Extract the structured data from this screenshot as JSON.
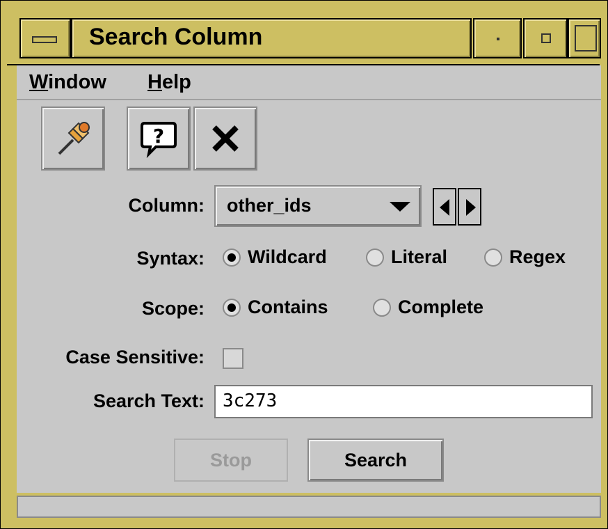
{
  "window": {
    "title": "Search Column"
  },
  "menubar": {
    "items": [
      {
        "label_mnemonic": "W",
        "label_rest": "indow"
      },
      {
        "label_mnemonic": "H",
        "label_rest": "elp"
      }
    ]
  },
  "toolbar": {
    "buttons": [
      "pin-icon",
      "help-icon",
      "close-icon"
    ]
  },
  "form": {
    "column": {
      "label": "Column:",
      "value": "other_ids"
    },
    "syntax": {
      "label": "Syntax:",
      "options": [
        "Wildcard",
        "Literal",
        "Regex"
      ],
      "selected": "Wildcard"
    },
    "scope": {
      "label": "Scope:",
      "options": [
        "Contains",
        "Complete"
      ],
      "selected": "Contains"
    },
    "case_sensitive": {
      "label": "Case Sensitive:",
      "checked": false
    },
    "search_text": {
      "label": "Search Text:",
      "value": "3c273"
    }
  },
  "actions": {
    "stop_label": "Stop",
    "search_label": "Search"
  },
  "colors": {
    "titlebar": "#cdbf62",
    "background": "#c8c8c8"
  }
}
